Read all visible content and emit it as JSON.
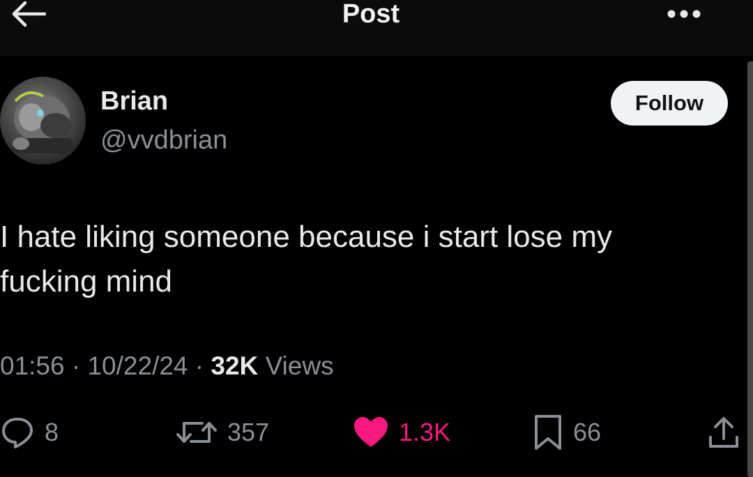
{
  "header": {
    "title": "Post",
    "back_icon": "arrow-left-icon",
    "more_icon": "more-horizontal-icon"
  },
  "author": {
    "name": "Brian",
    "handle": "@vvdbrian",
    "follow_label": "Follow"
  },
  "tweet": {
    "text": "I hate liking someone because i start lose my fucking mind"
  },
  "meta": {
    "time": "01:56",
    "date": "10/22/24",
    "views_count": "32K",
    "views_label": "Views",
    "separator": "·"
  },
  "actions": {
    "replies": "8",
    "reposts": "357",
    "likes": "1.3K",
    "bookmarks": "66"
  },
  "colors": {
    "background": "#000000",
    "text": "#e7e9ea",
    "secondary": "#8b9096",
    "like": "#f91880",
    "follow_bg": "#eff3f4"
  }
}
